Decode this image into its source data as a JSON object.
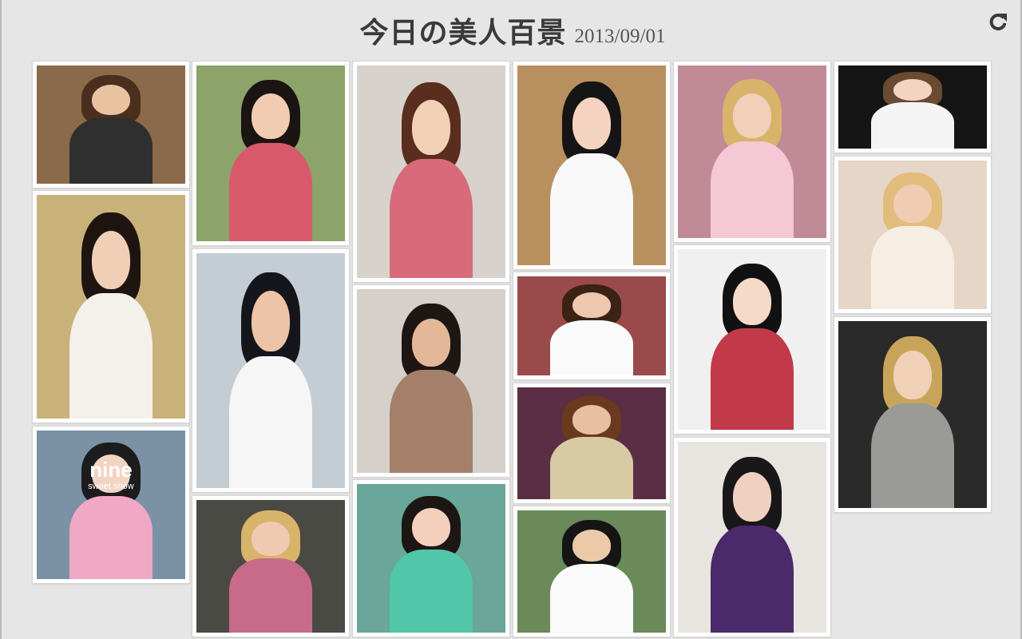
{
  "header": {
    "title": "今日の美人百景",
    "date": "2013/09/01",
    "reload_icon": "reload-icon"
  },
  "tiles": [
    {
      "id": "c1-1",
      "bg": "#8a6a4a",
      "hair": "#4a2e1e",
      "face": "#e9c2a0",
      "body": "#2f2f2f"
    },
    {
      "id": "c1-2",
      "bg": "#c9b27a",
      "hair": "#1e1410",
      "face": "#f1cfb6",
      "body": "#f4f0ea"
    },
    {
      "id": "c1-3",
      "bg": "#7b92a6",
      "hair": "#1c1c1c",
      "face": "#f2d4c2",
      "body": "#f0a8c4",
      "text": "nine",
      "subtext": "sweet snow"
    },
    {
      "id": "c2-1",
      "bg": "#8ca36a",
      "hair": "#1a1412",
      "face": "#f1cbb2",
      "body": "#d85a6a"
    },
    {
      "id": "c2-2",
      "bg": "#c4ccd4",
      "hair": "#15161c",
      "face": "#eec4a8",
      "body": "#f6f6f6"
    },
    {
      "id": "c2-3",
      "bg": "#4a4a44",
      "hair": "#d8b46a",
      "face": "#f0cab0",
      "body": "#c86a8a"
    },
    {
      "id": "c3-1",
      "bg": "#d8d2cc",
      "hair": "#5a2e1e",
      "face": "#f2d0b8",
      "body": "#d86a7a"
    },
    {
      "id": "c3-2",
      "bg": "#d6d0ca",
      "hair": "#1e1612",
      "face": "#e2b898",
      "body": "#a4806a"
    },
    {
      "id": "c3-3",
      "bg": "#6aa69a",
      "hair": "#1c1614",
      "face": "#f2d0bc",
      "body": "#52c6a8"
    },
    {
      "id": "c4-1",
      "bg": "#b89060",
      "hair": "#151515",
      "face": "#f4d4c0",
      "body": "#f8f8f8"
    },
    {
      "id": "c4-2",
      "bg": "#9a4a4a",
      "hair": "#3a2214",
      "face": "#eec8ae",
      "body": "#fafafa"
    },
    {
      "id": "c4-3",
      "bg": "#5a2e44",
      "hair": "#6a3a1e",
      "face": "#e6c0a0",
      "body": "#d8cba4"
    },
    {
      "id": "c4-4",
      "bg": "#6a8a5a",
      "hair": "#151515",
      "face": "#eccaa8",
      "body": "#fafafa"
    },
    {
      "id": "c5-1",
      "bg": "#c08a96",
      "hair": "#d8b46a",
      "face": "#f0d0b8",
      "body": "#f4c8d4"
    },
    {
      "id": "c5-2",
      "bg": "#f0f0f0",
      "hair": "#111111",
      "face": "#f6dac8",
      "body": "#c23a4a"
    },
    {
      "id": "c5-3",
      "bg": "#e8e4e0",
      "hair": "#181818",
      "face": "#f0d0c0",
      "body": "#4a2a6a"
    },
    {
      "id": "c6-1",
      "bg": "#151515",
      "hair": "#6a4a30",
      "face": "#f2d4c0",
      "body": "#f4f4f4"
    },
    {
      "id": "c6-2",
      "bg": "#e6d6c8",
      "hair": "#e2bc7a",
      "face": "#f0ccb4",
      "body": "#f6eee2"
    },
    {
      "id": "c6-3",
      "bg": "#2a2a2a",
      "hair": "#c8a45a",
      "face": "#f0d0b6",
      "body": "#9a9a96"
    }
  ]
}
